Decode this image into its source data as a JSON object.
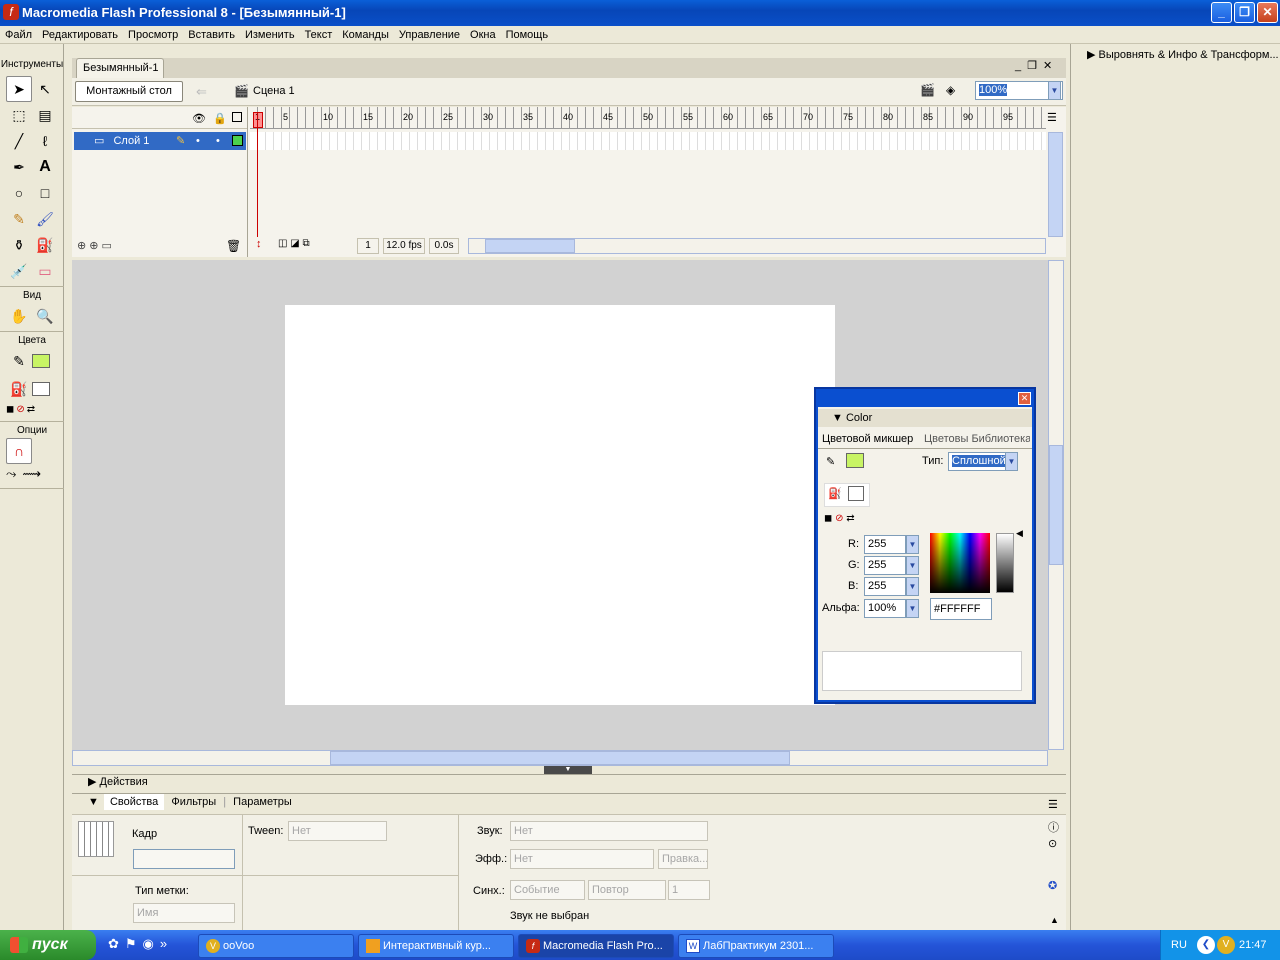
{
  "window": {
    "title": "Macromedia Flash Professional 8 - [Безымянный-1]",
    "min": "_",
    "max": "❐",
    "close": "✕"
  },
  "menu": [
    "Файл",
    "Редактировать",
    "Просмотр",
    "Вставить",
    "Изменить",
    "Текст",
    "Команды",
    "Управление",
    "Окна",
    "Помощь"
  ],
  "tools": {
    "header": "Инструменты",
    "view_label": "Вид",
    "colors_label": "Цвета",
    "options_label": "Опции"
  },
  "right_panel": {
    "title": "Выровнять & Инфо & Трансформ..."
  },
  "document": {
    "tab": "Безымянный-1",
    "stage_button": "Монтажный стол",
    "scene": "Сцена 1",
    "zoom": "100%",
    "layer_name": "Слой 1",
    "ruler": [
      "1",
      "5",
      "10",
      "15",
      "20",
      "25",
      "30",
      "35",
      "40",
      "45",
      "50",
      "55",
      "60",
      "65",
      "70",
      "75",
      "80",
      "85",
      "90",
      "95"
    ],
    "frame": "1",
    "fps": "12.0 fps",
    "time": "0.0s"
  },
  "color_panel": {
    "title": "Color",
    "tab_mixer": "Цветовой микшер",
    "tab_swatches": "Цветовы Библиотека",
    "type_label": "Тип:",
    "type_value": "Сплошной",
    "r_label": "R:",
    "r": "255",
    "g_label": "G:",
    "g": "255",
    "b_label": "B:",
    "b": "255",
    "alpha_label": "Альфа:",
    "alpha": "100%",
    "hex": "#FFFFFF",
    "stroke_color": "#c8f464",
    "fill_color": "#ffffff"
  },
  "panels": {
    "actions": "Действия",
    "props_tab": "Свойства",
    "filters_tab": "Фильтры",
    "params_tab": "Параметры"
  },
  "props": {
    "frame_label": "Кадр",
    "tween_label": "Tween:",
    "tween_value": "Нет",
    "sound_label": "Звук:",
    "sound_value": "Нет",
    "effect_label": "Эфф.:",
    "effect_value": "Нет",
    "edit_button": "Правка...",
    "sync_label": "Синх.:",
    "sync_value": "Событие",
    "repeat_value": "Повтор",
    "repeat_count": "1",
    "label_type": "Тип метки:",
    "label_type_value": "Имя",
    "no_sound": "Звук не выбран"
  },
  "taskbar": {
    "start": "пуск",
    "tasks": [
      "ooVoo",
      "Интерактивный кур...",
      "Macromedia Flash Pro...",
      "ЛабПрактикум 2301..."
    ],
    "lang": "RU",
    "clock": "21:47"
  }
}
